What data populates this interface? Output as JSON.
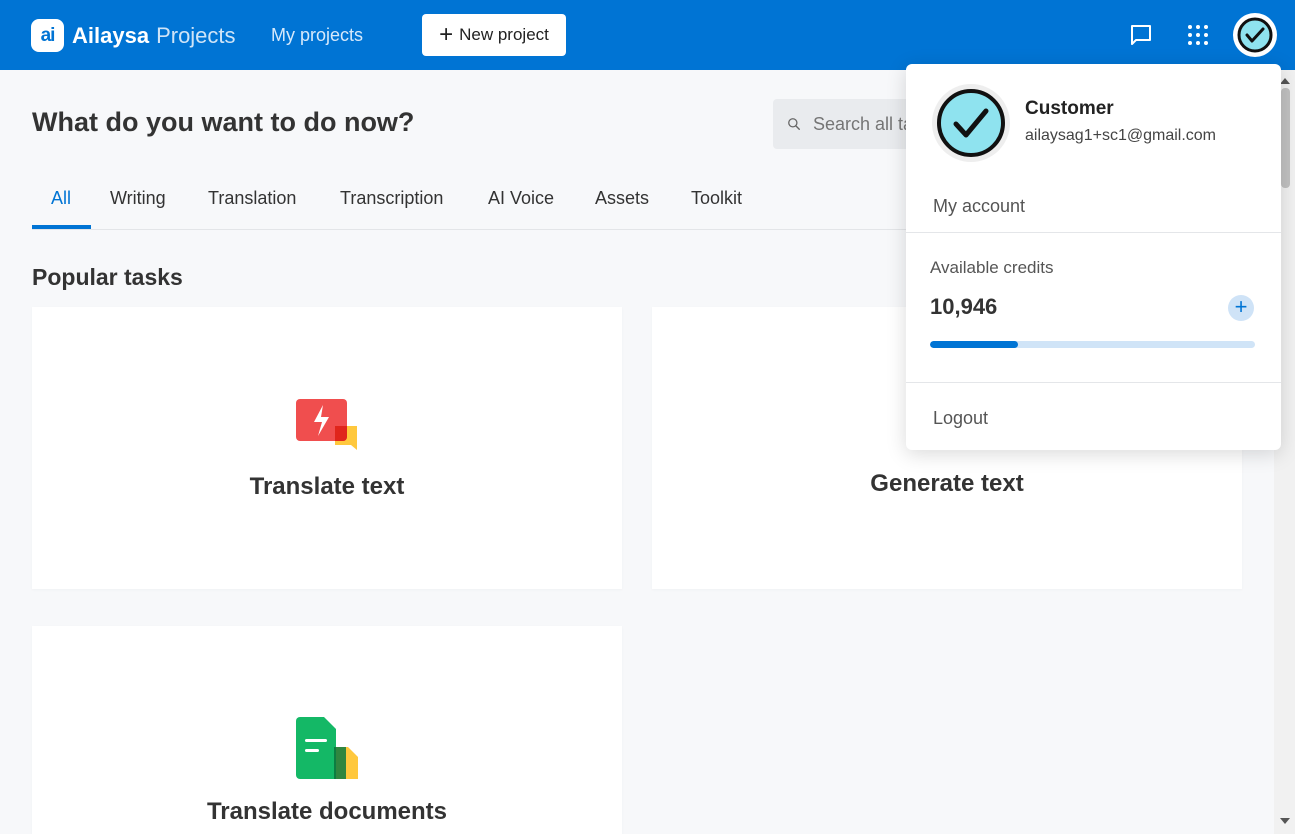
{
  "header": {
    "logo_mark": "ai",
    "logo_name": "Ailaysa",
    "logo_product": "Projects",
    "nav_link": "My projects",
    "new_project_label": "New project",
    "icons": [
      "chat-icon",
      "apps-grid-icon",
      "avatar"
    ]
  },
  "main": {
    "heading": "What do you want to do now?",
    "search_placeholder": "Search all tasks",
    "tabs": [
      {
        "label": "All",
        "active": true
      },
      {
        "label": "Writing",
        "active": false
      },
      {
        "label": "Translation",
        "active": false
      },
      {
        "label": "Transcription",
        "active": false
      },
      {
        "label": "AI Voice",
        "active": false
      },
      {
        "label": "Assets",
        "active": false
      },
      {
        "label": "Toolkit",
        "active": false
      }
    ],
    "section_title": "Popular tasks",
    "cards": [
      {
        "title": "Translate text",
        "icon": "translate-text-icon"
      },
      {
        "title": "Generate text",
        "icon": ""
      },
      {
        "title": "Translate documents",
        "icon": "translate-documents-icon"
      }
    ]
  },
  "account_menu": {
    "name": "Customer",
    "email": "ailaysag1+sc1@gmail.com",
    "my_account": "My account",
    "credits_label": "Available credits",
    "credits_value": "10,946",
    "credits_fraction": 0.27,
    "logout": "Logout"
  },
  "colors": {
    "brand_blue": "#0074d4",
    "background": "#f7f8fa",
    "red_icon": "#f04e4e",
    "yellow_icon": "#ffc83d",
    "green_icon": "#14b866"
  }
}
